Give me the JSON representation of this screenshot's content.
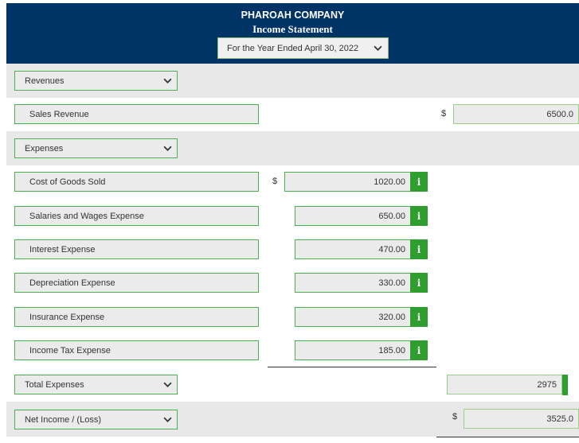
{
  "header": {
    "company": "PHAROAH COMPANY",
    "statement": "Income Statement",
    "period": "For the Year Ended April 30, 2022"
  },
  "rows": {
    "revenues": "Revenues",
    "sales_revenue": "Sales Revenue",
    "sales_revenue_value": "6500.0",
    "expenses": "Expenses",
    "cogs": "Cost of Goods Sold",
    "cogs_value": "1020.00",
    "salaries": "Salaries and Wages Expense",
    "salaries_value": "650.00",
    "interest": "Interest Expense",
    "interest_value": "470.00",
    "depreciation": "Depreciation Expense",
    "depreciation_value": "330.00",
    "insurance": "Insurance Expense",
    "insurance_value": "320.00",
    "income_tax": "Income Tax Expense",
    "income_tax_value": "185.00",
    "total_expenses": "Total Expenses",
    "total_expenses_value": "2975",
    "net_income": "Net Income / (Loss)",
    "net_income_value": "3525.0"
  },
  "symbols": {
    "dollar": "$",
    "info": "i"
  },
  "colors": {
    "header_bg": "#003366",
    "accent_green": "#2e9e2e",
    "band_bg": "#e8e8e8"
  }
}
